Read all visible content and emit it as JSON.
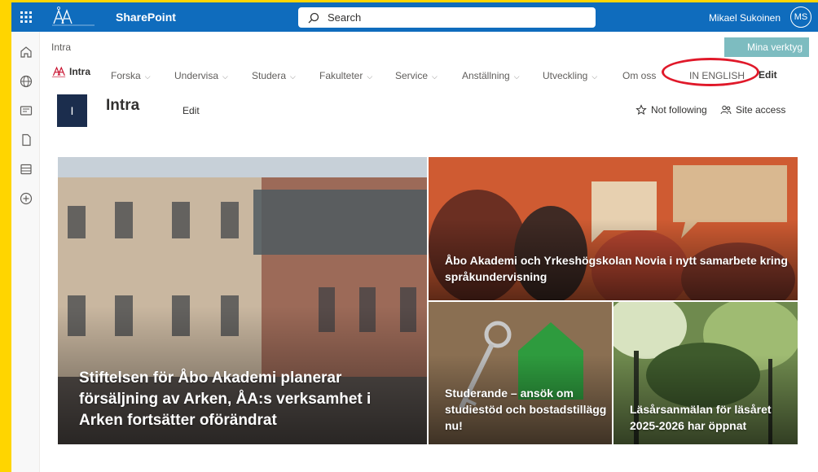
{
  "suitebar": {
    "app_name": "SharePoint",
    "search_placeholder": "Search",
    "user_name": "Mikael Sukoinen",
    "user_initials": "MS",
    "accent": "#0f6cbd",
    "logo_text": "Åbo Akademi"
  },
  "breadcrumb": "Intra",
  "tools_button": "Mina verktyg",
  "hub": {
    "logo_label": "Intra",
    "items": [
      {
        "label": "Forska",
        "chevron": "⌵"
      },
      {
        "label": "Undervisa",
        "chevron": "⌵"
      },
      {
        "label": "Studera",
        "chevron": "⌵"
      },
      {
        "label": "Fakulteter",
        "chevron": "⌵"
      },
      {
        "label": "Service",
        "chevron": "⌵"
      },
      {
        "label": "Anställning",
        "chevron": "⌵"
      },
      {
        "label": "Utveckling",
        "chevron": "⌵"
      },
      {
        "label": "Om oss"
      },
      {
        "label": "IN ENGLISH"
      }
    ],
    "edit": "Edit"
  },
  "site": {
    "tile_letter": "I",
    "title": "Intra",
    "edit": "Edit",
    "follow": "Not following",
    "access": "Site access"
  },
  "news": [
    {
      "title": "Stiftelsen för Åbo Akademi planerar försäljning av Arken, ÅA:s verksamhet i Arken fortsätter oförändrat"
    },
    {
      "title": "Åbo Akademi och Yrkeshögskolan Novia i nytt samarbete kring språkundervisning"
    },
    {
      "title": "Studerande – ansök om studiestöd och bostadstillägg nu!"
    },
    {
      "title": "Läsårsanmälan för läsåret 2025-2026 har öppnat"
    }
  ],
  "colors": {
    "highlight_circle": "#e0192a",
    "frame": "#ffd500",
    "tools": "#7dbcc0",
    "site_tile": "#1b2d4d"
  }
}
